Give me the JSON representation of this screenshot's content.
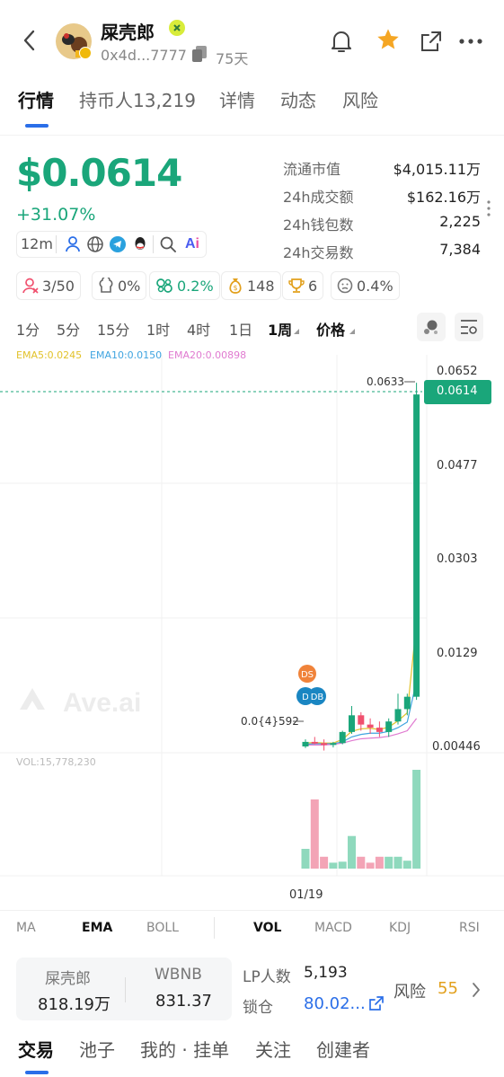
{
  "header": {
    "token_name": "屎壳郎",
    "address": "0x4d...7777",
    "age": "75天"
  },
  "tabs": [
    {
      "label": "行情"
    },
    {
      "label": "持币人13,219"
    },
    {
      "label": "详情"
    },
    {
      "label": "动态"
    },
    {
      "label": "风险"
    }
  ],
  "price": {
    "value": "$0.0614",
    "change": "+31.07%",
    "interval": "12m"
  },
  "stats": [
    {
      "label": "流通市值",
      "value": "$4,015.11万"
    },
    {
      "label": "24h成交额",
      "value": "$162.16万"
    },
    {
      "label": "24h钱包数",
      "value": "2,225"
    },
    {
      "label": "24h交易数",
      "value": "7,384"
    }
  ],
  "badges": [
    {
      "icon": "user-icon",
      "value": "3/50"
    },
    {
      "icon": "chef-hat-icon",
      "value": "0%"
    },
    {
      "icon": "link-icon",
      "value": "0.2%"
    },
    {
      "icon": "money-bag-icon",
      "value": "148"
    },
    {
      "icon": "trophy-icon",
      "value": "6"
    },
    {
      "icon": "face-icon",
      "value": "0.4%"
    }
  ],
  "timeframes": [
    "1分",
    "5分",
    "15分",
    "1时",
    "4时",
    "1日",
    "1周",
    "价格"
  ],
  "ema": {
    "ema5": "EMA5:0.0245",
    "ema10": "EMA10:0.0150",
    "ema20": "EMA20:0.00898"
  },
  "watermark": "Ave.ai",
  "vol_label": "VOL:15,778,230",
  "x_label": "01/19",
  "markers": {
    "ds": "DS",
    "d": "D",
    "db": "DB"
  },
  "indicators_left": [
    "MA",
    "EMA",
    "BOLL"
  ],
  "indicators_right": [
    "VOL",
    "MACD",
    "KDJ",
    "RSI"
  ],
  "pool": {
    "token_label": "屎壳郎",
    "token_amount": "818.19万",
    "pair_label": "WBNB",
    "pair_amount": "831.37",
    "lp_label": "LP人数",
    "lp_value": "5,193",
    "lock_label": "锁仓",
    "lock_value": "80.02...",
    "risk_label": "风险",
    "risk_value": "55"
  },
  "bottom_tabs": [
    "交易",
    "池子",
    "我的 · 挂单",
    "关注",
    "创建者"
  ],
  "colors": {
    "up": "#1aa67a",
    "down": "#f0506e",
    "accent": "#2a6ee8",
    "star": "#f5a623",
    "risk": "#e2a01d"
  },
  "chart_data": {
    "type": "candlestick",
    "price_ticks": [
      "0.0652",
      "0.0477",
      "0.0303",
      "0.0129",
      "0.00446"
    ],
    "ylim": [
      0.00446,
      0.0652
    ],
    "current_price": "0.0614",
    "high_label": "0.0633",
    "low_label": "0.0{4}592",
    "x_ticks": [
      "01/19"
    ],
    "candles": [
      {
        "o": 0.00446,
        "h": 0.0056,
        "l": 0.0042,
        "c": 0.0052
      },
      {
        "o": 0.0052,
        "h": 0.006,
        "l": 0.0048,
        "c": 0.005
      },
      {
        "o": 0.005,
        "h": 0.0056,
        "l": 0.0038,
        "c": 0.0047
      },
      {
        "o": 0.0047,
        "h": 0.0052,
        "l": 0.0043,
        "c": 0.005
      },
      {
        "o": 0.005,
        "h": 0.007,
        "l": 0.0048,
        "c": 0.0068
      },
      {
        "o": 0.0068,
        "h": 0.011,
        "l": 0.0065,
        "c": 0.0095
      },
      {
        "o": 0.0095,
        "h": 0.01,
        "l": 0.007,
        "c": 0.008
      },
      {
        "o": 0.008,
        "h": 0.009,
        "l": 0.0065,
        "c": 0.0075
      },
      {
        "o": 0.0075,
        "h": 0.0085,
        "l": 0.006,
        "c": 0.0068
      },
      {
        "o": 0.0068,
        "h": 0.009,
        "l": 0.006,
        "c": 0.0085
      },
      {
        "o": 0.0085,
        "h": 0.013,
        "l": 0.008,
        "c": 0.0105
      },
      {
        "o": 0.0105,
        "h": 0.013,
        "l": 0.0095,
        "c": 0.0125
      },
      {
        "o": 0.0125,
        "h": 0.0633,
        "l": 0.012,
        "c": 0.0614
      }
    ],
    "ema_values": {
      "ema5": [
        0.005,
        0.0051,
        0.005,
        0.005,
        0.0056,
        0.0069,
        0.0073,
        0.0074,
        0.0072,
        0.0076,
        0.0086,
        0.0099,
        0.0245
      ],
      "ema10": [
        0.0048,
        0.0049,
        0.0049,
        0.0049,
        0.0052,
        0.006,
        0.0064,
        0.0066,
        0.0066,
        0.0069,
        0.0075,
        0.0084,
        0.015
      ],
      "ema20": [
        0.0047,
        0.0047,
        0.0047,
        0.0048,
        0.005,
        0.0054,
        0.0057,
        0.0058,
        0.0059,
        0.0061,
        0.0065,
        0.007,
        0.00898
      ]
    },
    "volume": [
      0.2,
      0.7,
      0.12,
      0.06,
      0.07,
      0.33,
      0.12,
      0.06,
      0.12,
      0.12,
      0.12,
      0.08,
      1.0
    ]
  }
}
